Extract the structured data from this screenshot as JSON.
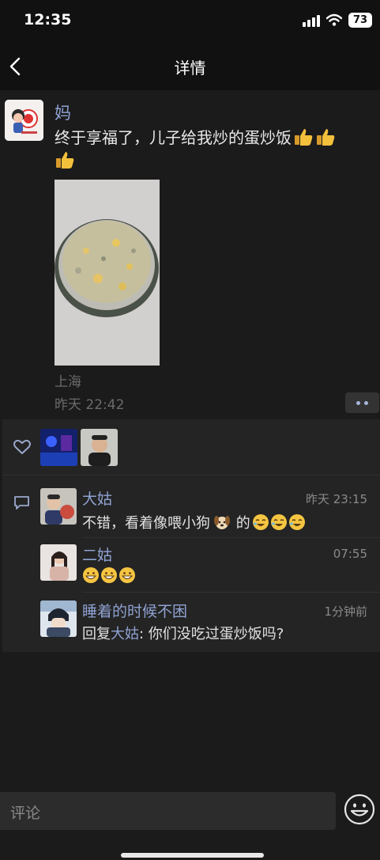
{
  "status_bar": {
    "time": "12:35",
    "battery": "73"
  },
  "nav": {
    "title": "详情"
  },
  "post": {
    "author": "妈",
    "text": "终于享福了，儿子给我炒的蛋炒饭",
    "emoji_suffix": [
      "thumbs-up",
      "thumbs-up",
      "thumbs-up"
    ],
    "location": "上海",
    "time": "昨天 22:42"
  },
  "comments": [
    {
      "name": "大姑",
      "time": "昨天 23:15",
      "text_before": "不错，看着像喂小狗",
      "text_after": " 的"
    },
    {
      "name": "二姑",
      "time": "07:55"
    },
    {
      "name": "睡着的时候不困",
      "time": "1分钟前",
      "reply_prefix": "回复",
      "reply_to": "大姑",
      "reply_text": ": 你们没吃过蛋炒饭吗?"
    }
  ],
  "comment_bar": {
    "placeholder": "评论"
  },
  "colors": {
    "background": "#1b1b1b",
    "name_blue": "#8fa2d2",
    "panel": "#242424"
  }
}
